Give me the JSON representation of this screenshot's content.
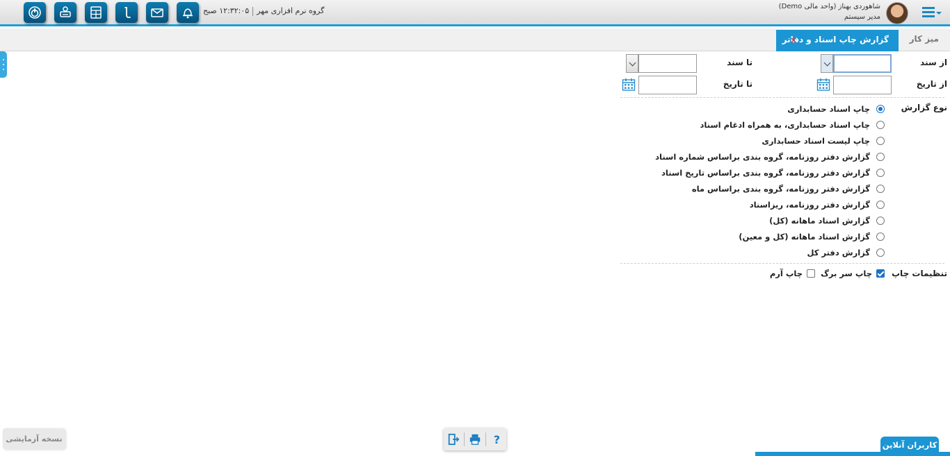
{
  "header": {
    "company": "گروه نرم افزاری مهر",
    "clock": "۱۲:۳۲:۰۵ صبح",
    "user_name": "شاهوردی بهناز (واحد مالی Demo)",
    "user_role": "مدیر سیستم",
    "toolbar_icons": [
      "power-icon",
      "printer-user-icon",
      "calculator-icon",
      "phone-icon",
      "mail-icon",
      "bell-icon"
    ]
  },
  "tabs": {
    "desk": "میز کار",
    "active": "گزارش چاپ اسناد و دفاتر",
    "close": "×"
  },
  "form": {
    "from_doc_label": "از سند",
    "to_doc_label": "تا سند",
    "from_date_label": "از تاریخ",
    "to_date_label": "تا تاریخ",
    "from_doc_value": "",
    "to_doc_value": "",
    "from_date_value": "",
    "to_date_value": "",
    "report_type_label": "نوع گزارش",
    "report_types": [
      {
        "label": "چاپ اسناد حسابداری",
        "selected": true
      },
      {
        "label": "چاپ اسناد حسابداری، به همراه ادغام اسناد",
        "selected": false
      },
      {
        "label": "چاپ لیست اسناد حسابداری",
        "selected": false
      },
      {
        "label": "گزارش دفتر روزنامه، گروه بندی براساس شماره اسناد",
        "selected": false
      },
      {
        "label": "گزارش دفتر روزنامه، گروه بندی براساس تاریخ اسناد",
        "selected": false
      },
      {
        "label": "گزارش دفتر روزنامه، گروه بندی براساس ماه",
        "selected": false
      },
      {
        "label": "گزارش دفتر روزنامه، ریزاسناد",
        "selected": false
      },
      {
        "label": "گزارش اسناد ماهانه (کل)",
        "selected": false
      },
      {
        "label": "گزارش اسناد ماهانه (کل و معین)",
        "selected": false
      },
      {
        "label": "گزارش دفتر کل",
        "selected": false
      }
    ],
    "print_settings_label": "تنظیمات چاپ",
    "print_header_label": "چاپ سر برگ",
    "print_header_checked": true,
    "print_logo_label": "چاپ آرم",
    "print_logo_checked": false
  },
  "footer": {
    "trial_version": "نسخه آزمایشی",
    "online_users": "کاربران آنلاین",
    "help_label": "?"
  },
  "colors": {
    "accent": "#1b95d3",
    "toolbar_button": "#0a6596"
  }
}
